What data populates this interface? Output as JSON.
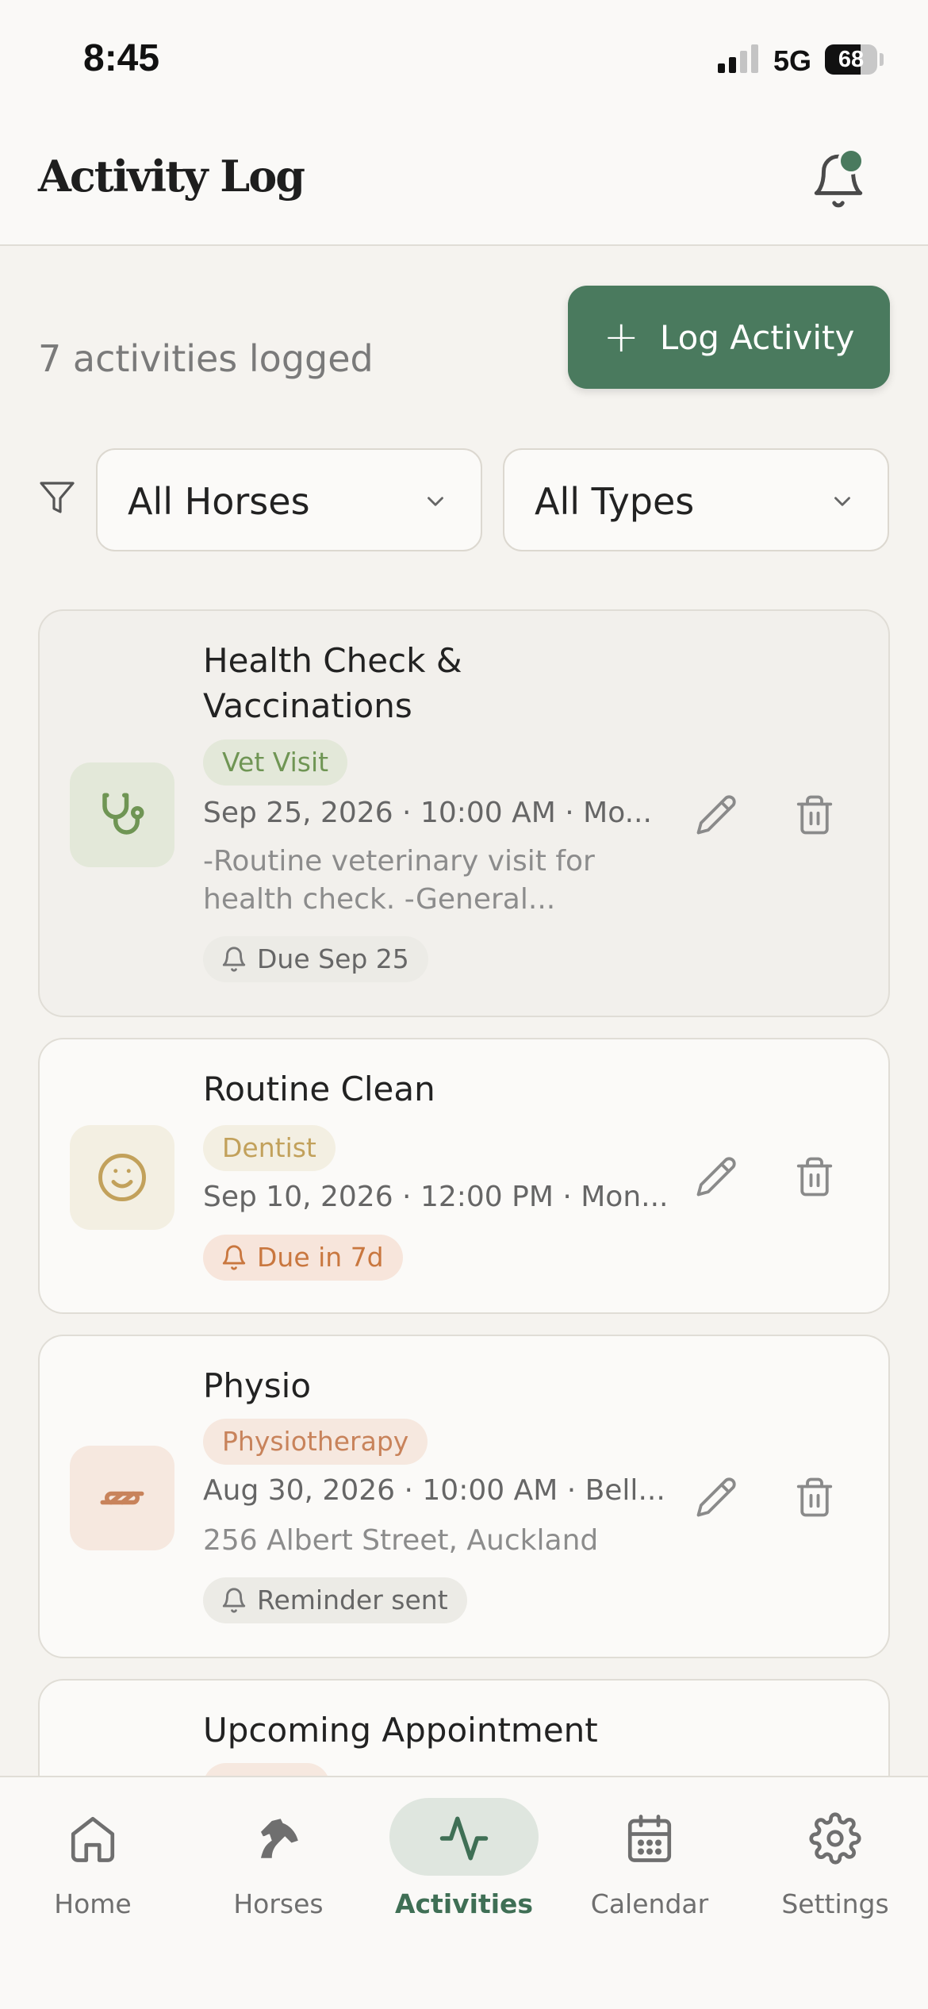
{
  "status_bar": {
    "time": "8:45",
    "network": "5G",
    "battery_level": "68",
    "battery_fraction": 0.68
  },
  "header": {
    "title": "Activity Log",
    "notification_icon": "bell-icon",
    "has_unread": true
  },
  "summary": {
    "count_text": "7 activities logged"
  },
  "log_button": {
    "icon": "plus-icon",
    "label": "Log Activity"
  },
  "filters": {
    "icon": "filter-icon",
    "horse": {
      "value": "All Horses"
    },
    "type": {
      "value": "All Types"
    }
  },
  "colors": {
    "accent": "#4a7a5e",
    "vet_bg": "#e3e8d9",
    "vet_fg": "#6f9554",
    "dentist_bg": "#f3efe2",
    "dentist_fg": "#c2a15b",
    "physio_bg": "#f6e8df",
    "physio_fg": "#c8835b",
    "due_neutral_bg": "#ecebe6",
    "due_warn_bg": "#f7e5db",
    "due_warn_fg": "#c9773f"
  },
  "activities": [
    {
      "title": "Health Check & Vaccinations",
      "type": "Vet Visit",
      "icon": "stethoscope-icon",
      "meta": "Sep 25, 2026 · 10:00 AM · Mo...",
      "note": "-Routine veterinary visit for health check. -General...",
      "reminder": "Due Sep 25",
      "reminder_icon": "bell-icon"
    },
    {
      "title": "Routine Clean",
      "type": "Dentist",
      "icon": "smile-icon",
      "meta": "Sep 10, 2026 · 12:00 PM · Mon...",
      "reminder": "Due in 7d",
      "reminder_icon": "bell-icon"
    },
    {
      "title": "Physio",
      "type": "Physiotherapy",
      "icon": "hand-icon",
      "meta": "Aug 30, 2026 · 10:00 AM · Bell...",
      "note": "256 Albert Street, Auckland",
      "reminder": "Reminder sent",
      "reminder_icon": "bell-icon"
    },
    {
      "title": "Upcoming Appointment"
    }
  ],
  "tabs": [
    {
      "label": "Home",
      "icon": "home-icon"
    },
    {
      "label": "Horses",
      "icon": "horse-icon"
    },
    {
      "label": "Activities",
      "icon": "activity-icon",
      "active": true
    },
    {
      "label": "Calendar",
      "icon": "calendar-icon"
    },
    {
      "label": "Settings",
      "icon": "gear-icon"
    }
  ]
}
